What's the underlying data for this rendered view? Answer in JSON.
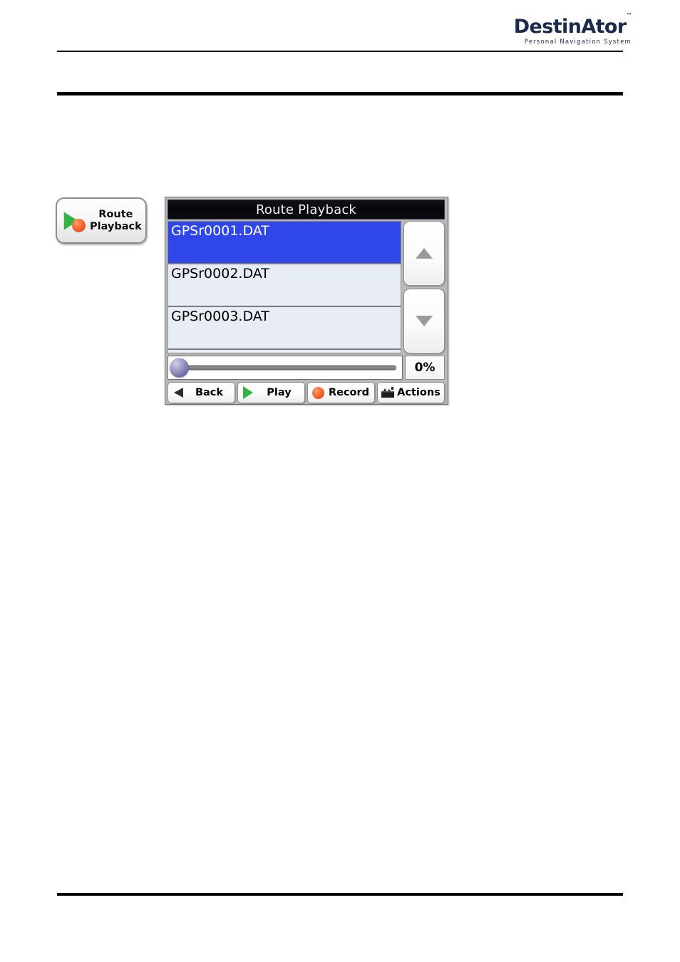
{
  "page": {
    "brand": {
      "name": "DestinAtor",
      "trademark": "™",
      "tagline": "Personal Navigation System"
    }
  },
  "side_button": {
    "label_line1": "Route",
    "label_line2": "Playback",
    "icon_play": "play-triangle-icon",
    "icon_record": "record-dot-icon"
  },
  "device": {
    "title": "Route Playback",
    "list": {
      "items": [
        {
          "name": "GPSr0001.DAT",
          "selected": true
        },
        {
          "name": "GPSr0002.DAT",
          "selected": false
        },
        {
          "name": "GPSr0003.DAT",
          "selected": false
        }
      ]
    },
    "scroll": {
      "up_icon": "triangle-up-icon",
      "down_icon": "triangle-down-icon"
    },
    "progress": {
      "value": 0,
      "value_label": "0%"
    },
    "toolbar": [
      {
        "label": "Back",
        "icon": "triangle-left-icon"
      },
      {
        "label": "Play",
        "icon": "play-triangle-icon"
      },
      {
        "label": "Record",
        "icon": "record-dot-icon"
      },
      {
        "label": "Actions",
        "icon": "actions-icon"
      }
    ]
  },
  "colors": {
    "selected_row": "#2f47e8",
    "list_background": "#e8ecf5",
    "record_orange": "#f4622a",
    "play_green": "#33b341",
    "slider_knob": "#6d6da8",
    "brand_navy": "#1b2a4a"
  }
}
